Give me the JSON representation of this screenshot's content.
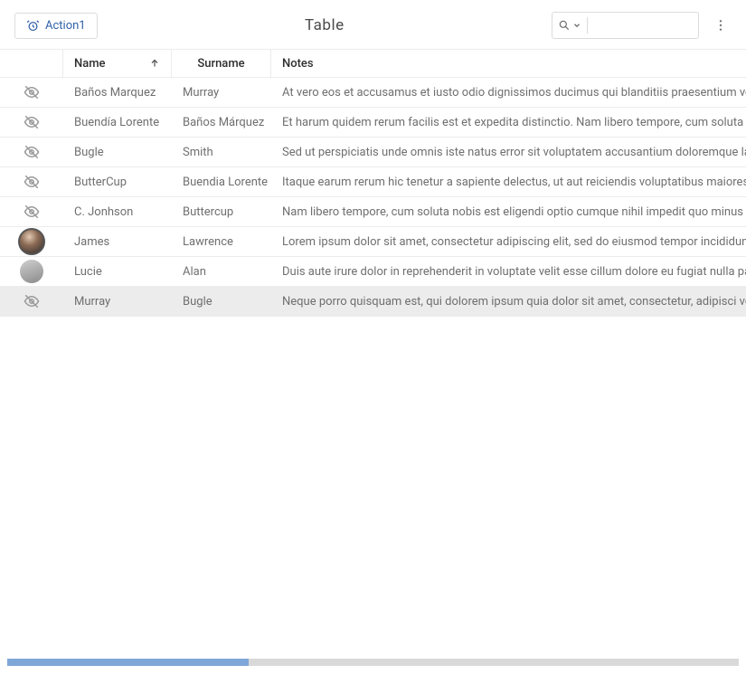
{
  "toolbar": {
    "action_label": "Action1",
    "title": "Table",
    "search_placeholder": ""
  },
  "columns": {
    "avatar": "",
    "name": "Name",
    "surname": "Surname",
    "notes": "Notes"
  },
  "sort": {
    "column": "name",
    "dir": "asc"
  },
  "rows": [
    {
      "avatar": "none",
      "name": "Baños Marquez",
      "surname": "Murray",
      "notes": "At vero eos et accusamus et iusto odio dignissimos ducimus qui blanditiis praesentium volup",
      "highlight": false
    },
    {
      "avatar": "none",
      "name": "Buendía Lorente",
      "surname": "Baños Márquez",
      "notes": "Et harum quidem rerum facilis est et expedita distinctio. Nam libero tempore, cum soluta nob",
      "highlight": false
    },
    {
      "avatar": "none",
      "name": "Bugle",
      "surname": "Smith",
      "notes": "Sed ut perspiciatis unde omnis iste natus error sit voluptatem accusantium doloremque laud",
      "highlight": false
    },
    {
      "avatar": "none",
      "name": "ButterCup",
      "surname": "Buendia Lorente",
      "notes": "Itaque earum rerum hic tenetur a sapiente delectus, ut aut reiciendis voluptatibus maiores al",
      "highlight": false
    },
    {
      "avatar": "none",
      "name": "C. Jonhson",
      "surname": "Buttercup",
      "notes": "Nam libero tempore, cum soluta nobis est eligendi optio cumque nihil impedit quo minus id q",
      "highlight": false
    },
    {
      "avatar": "img-dark",
      "name": "James",
      "surname": "Lawrence",
      "notes": "Lorem ipsum dolor sit amet, consectetur adipiscing elit, sed do eiusmod tempor incididunt ut",
      "highlight": false
    },
    {
      "avatar": "img-gray",
      "name": "Lucie",
      "surname": "Alan",
      "notes": "Duis aute irure dolor in reprehenderit in voluptate velit esse cillum dolore eu fugiat nulla paria",
      "highlight": false
    },
    {
      "avatar": "none",
      "name": "Murray",
      "surname": "Bugle",
      "notes": "Neque porro quisquam est, qui dolorem ipsum quia dolor sit amet, consectetur, adipisci velit,",
      "highlight": true
    }
  ]
}
